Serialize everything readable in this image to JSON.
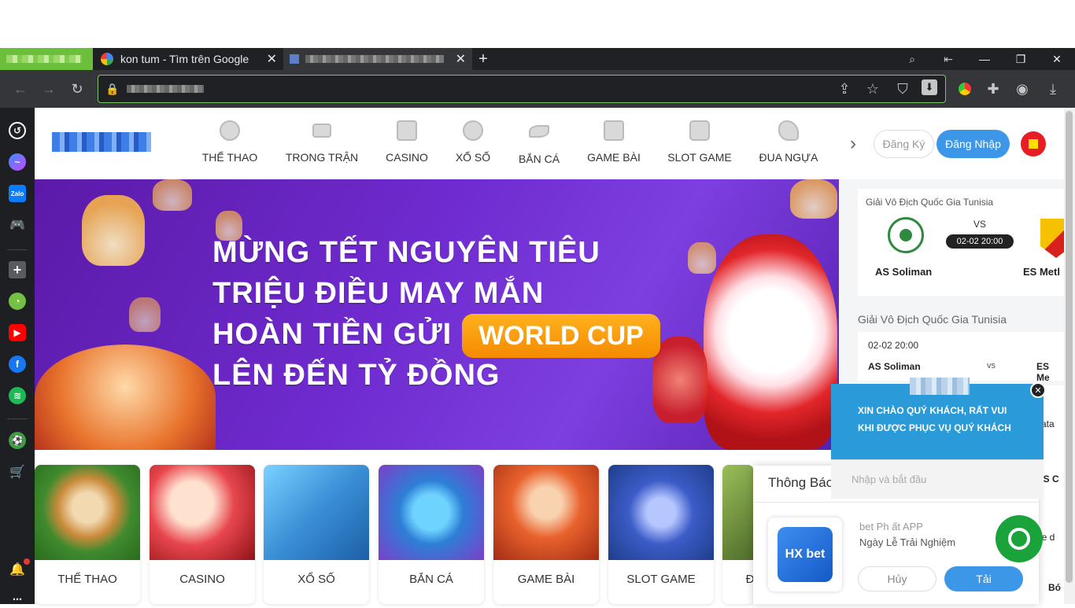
{
  "browser": {
    "tabs": [
      {
        "title": "kon tum - Tìm trên Google",
        "active": false
      },
      {
        "title": "",
        "active": true
      }
    ],
    "new_tab_label": "+",
    "window_controls": {
      "minimize": "—",
      "maximize": "❐",
      "close": "✕"
    }
  },
  "site": {
    "nav": [
      {
        "label": "THỂ THAO",
        "icon": "soccer-ball-icon"
      },
      {
        "label": "TRONG TRẬN",
        "icon": "video-camera-icon"
      },
      {
        "label": "CASINO",
        "icon": "cards-icon"
      },
      {
        "label": "XỔ SỐ",
        "icon": "lottery-ball-icon"
      },
      {
        "label": "BẮN CÁ",
        "icon": "fish-icon"
      },
      {
        "label": "GAME BÀI",
        "icon": "playing-card-icon"
      },
      {
        "label": "SLOT GAME",
        "icon": "slot-machine-icon"
      },
      {
        "label": "ĐUA NGỰA",
        "icon": "horse-icon"
      }
    ],
    "register_label": "Đăng Ký",
    "login_label": "Đăng Nhập",
    "nav_next": "›"
  },
  "banner": {
    "line1": "MỪNG TẾT NGUYÊN TIÊU",
    "line2": "TRIỆU ĐIỀU MAY MẮN",
    "line3": "HOÀN TIỀN GỬI",
    "badge": "WORLD CUP",
    "line4": "LÊN ĐẾN TỶ ĐỒNG"
  },
  "matches": {
    "featured": {
      "league": "Giải Vô Địch Quốc Gia Tunisia",
      "vs": "VS",
      "time": "02-02 20:00",
      "home": "AS Soliman",
      "away": "ES Metl"
    },
    "section_title": "Giải Vô Địch Quốc Gia Tunisia",
    "list": [
      {
        "time": "02-02 20:00",
        "home": "AS Soliman",
        "vs": "vs",
        "away": "ES Me"
      }
    ],
    "partials": [
      "Tata",
      "CS C",
      "ue d",
      "Bó"
    ]
  },
  "categories": [
    {
      "label": "THỂ THAO",
      "color": "#3f8a2e"
    },
    {
      "label": "CASINO",
      "color": "#c2272d"
    },
    {
      "label": "XỔ SỐ",
      "color": "#3a8fd6"
    },
    {
      "label": "BẮN CÁ",
      "color": "#7b3fc9"
    },
    {
      "label": "GAME BÀI",
      "color": "#d8472a"
    },
    {
      "label": "SLOT GAME",
      "color": "#1f3d8a"
    },
    {
      "label": "Đ",
      "color": "#4e6b2a"
    }
  ],
  "notification": {
    "title": "Thông Báo",
    "line1": "bet Ph    ất    APP",
    "line2": "Ngày Lễ Trải Nghiệm",
    "cancel_label": "Hủy",
    "download_label": "Tải",
    "app_icon_text": "HX bet"
  },
  "chat": {
    "greeting_line1": "XIN CHÀO QUÝ KHÁCH, RẤT VUI",
    "greeting_line2": "KHI ĐƯỢC PHỤC VỤ QUÝ KHÁCH",
    "input_placeholder": "Nhập và bắt đầu",
    "close_label": "✕"
  },
  "colors": {
    "accent_blue": "#3d97e8",
    "banner_purple": "#6f2bcf",
    "badge_orange": "#f58a00",
    "chat_blue": "#2b9ad8",
    "chat_green": "#1aa33b"
  }
}
